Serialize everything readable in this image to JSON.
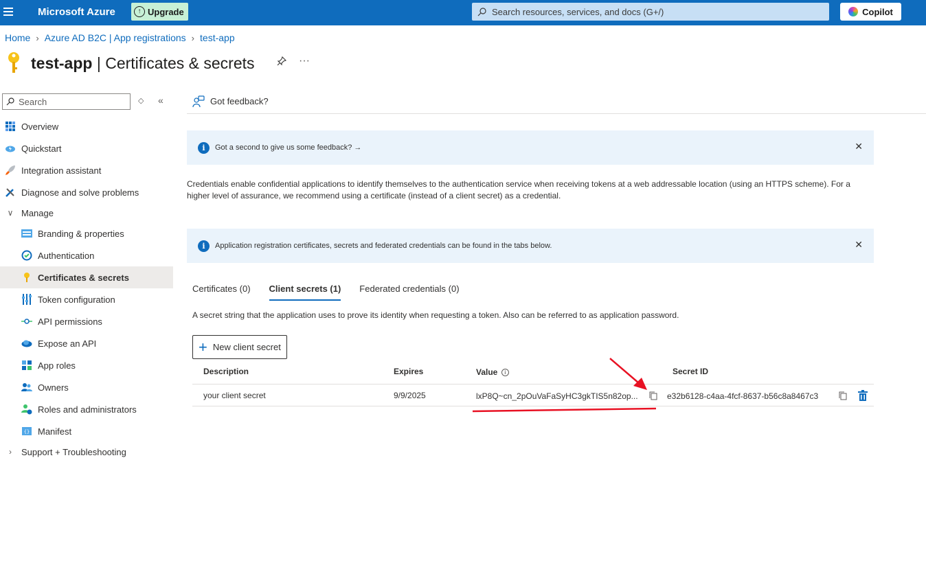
{
  "topbar": {
    "brand": "Microsoft Azure",
    "upgrade_label": "Upgrade",
    "search_placeholder": "Search resources, services, and docs (G+/)",
    "copilot_label": "Copilot",
    "color": "#0f6cbd"
  },
  "breadcrumb": [
    "Home",
    "Azure AD B2C | App registrations",
    "test-app"
  ],
  "page": {
    "app_name": "test-app",
    "section": "| Certificates & secrets"
  },
  "sidebar": {
    "search_placeholder": "Search",
    "items": [
      {
        "label": "Overview",
        "icon": "grid-icon"
      },
      {
        "label": "Quickstart",
        "icon": "cloud-lightning-icon"
      },
      {
        "label": "Integration assistant",
        "icon": "rocket-icon"
      },
      {
        "label": "Diagnose and solve problems",
        "icon": "wrench-icon"
      },
      {
        "label": "Manage",
        "icon": "chevron-down-icon"
      },
      {
        "label": "Branding & properties",
        "icon": "branding-icon"
      },
      {
        "label": "Authentication",
        "icon": "authentication-icon"
      },
      {
        "label": "Certificates & secrets",
        "icon": "key-icon"
      },
      {
        "label": "Token configuration",
        "icon": "token-bars-icon"
      },
      {
        "label": "API permissions",
        "icon": "api-permissions-icon"
      },
      {
        "label": "Expose an API",
        "icon": "cloud-icon"
      },
      {
        "label": "App roles",
        "icon": "app-roles-icon"
      },
      {
        "label": "Owners",
        "icon": "owners-icon"
      },
      {
        "label": "Roles and administrators",
        "icon": "roles-icon"
      },
      {
        "label": "Manifest",
        "icon": "manifest-icon"
      },
      {
        "label": "Support + Troubleshooting",
        "icon": "chevron-right-icon"
      }
    ]
  },
  "feedback_bar": {
    "label": "Got feedback?"
  },
  "banner1": {
    "text": "Got a second to give us some feedback? →"
  },
  "description": "Credentials enable confidential applications to identify themselves to the authentication service when receiving tokens at a web addressable location (using an HTTPS scheme). For a higher level of assurance, we recommend using a certificate (instead of a client secret) as a credential.",
  "banner2": {
    "text": "Application registration certificates, secrets and federated credentials can be found in the tabs below."
  },
  "tabs": [
    "Certificates (0)",
    "Client secrets (1)",
    "Federated credentials (0)"
  ],
  "tab_description": "A secret string that the application uses to prove its identity when requesting a token. Also can be referred to as application password.",
  "new_secret_label": "New client secret",
  "table": {
    "headers": [
      "Description",
      "Expires",
      "Value",
      "Secret ID"
    ],
    "rows": [
      {
        "description": "your client secret",
        "expires": "9/9/2025",
        "value": "lxP8Q~cn_2pOuVaFaSyHC3gkTIS5n82op...",
        "secret_id": "e32b6128-c4aa-4fcf-8637-b56c8a8467c3"
      }
    ]
  },
  "annotation_color": "#e81123"
}
